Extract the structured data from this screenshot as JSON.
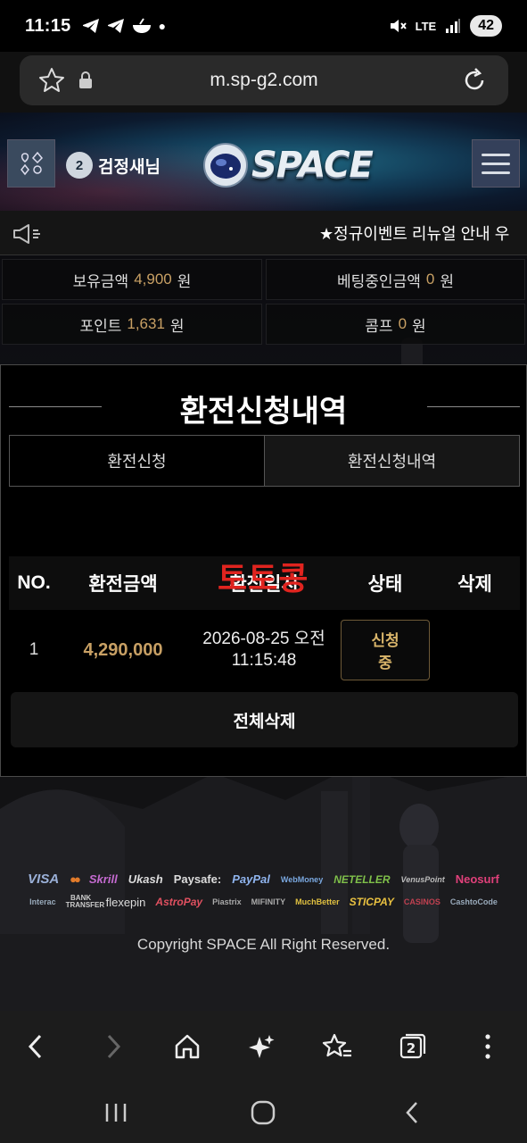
{
  "status_bar": {
    "time": "11:15",
    "network": "LTE",
    "battery": "42"
  },
  "browser": {
    "url": "m.sp-g2.com",
    "tab_count": "2"
  },
  "header": {
    "user_level": "2",
    "user_name": "검정새님",
    "logo_text": "SPACE"
  },
  "notice": {
    "text": "★정규이벤트 리뉴얼 안내 우"
  },
  "balances": [
    {
      "label": "보유금액",
      "amount": "4,900",
      "unit": "원"
    },
    {
      "label": "베팅중인금액",
      "amount": "0",
      "unit": "원"
    },
    {
      "label": "포인트",
      "amount": "1,631",
      "unit": "원"
    },
    {
      "label": "콤프",
      "amount": "0",
      "unit": "원"
    }
  ],
  "panel": {
    "title": "환전신청내역",
    "tabs": [
      {
        "label": "환전신청",
        "active": false
      },
      {
        "label": "환전신청내역",
        "active": true
      }
    ],
    "columns": [
      "NO.",
      "환전금액",
      "환전일시",
      "상태",
      "삭제"
    ],
    "watermark": "토토콩",
    "rows": [
      {
        "no": "1",
        "amount": "4,290,000",
        "date_line1": "2026-08-25 오전",
        "date_line2": "11:15:48",
        "status": "신청중"
      }
    ],
    "delete_all": "전체삭제"
  },
  "payments_row1": [
    "VISA",
    "●●",
    "Skrill",
    "Ukash",
    "Paysafe:",
    "PayPal",
    "WebMoney",
    "NETELLER",
    "VenusPoint",
    "Neosurf"
  ],
  "payments_row2": [
    "Interac",
    "BANK TRANSFER",
    "flexepin",
    "AstroPay",
    "Piastrix",
    "MIFINITY",
    "MuchBetter",
    "STICPAY",
    "CASINOS",
    "CashtoCode"
  ],
  "footer": {
    "copyright": "Copyright SPACE All Right Reserved."
  },
  "colors": {
    "accent_gold": "#c8a064",
    "watermark_red": "#e0241f",
    "panel_border": "#4a4a4a"
  }
}
